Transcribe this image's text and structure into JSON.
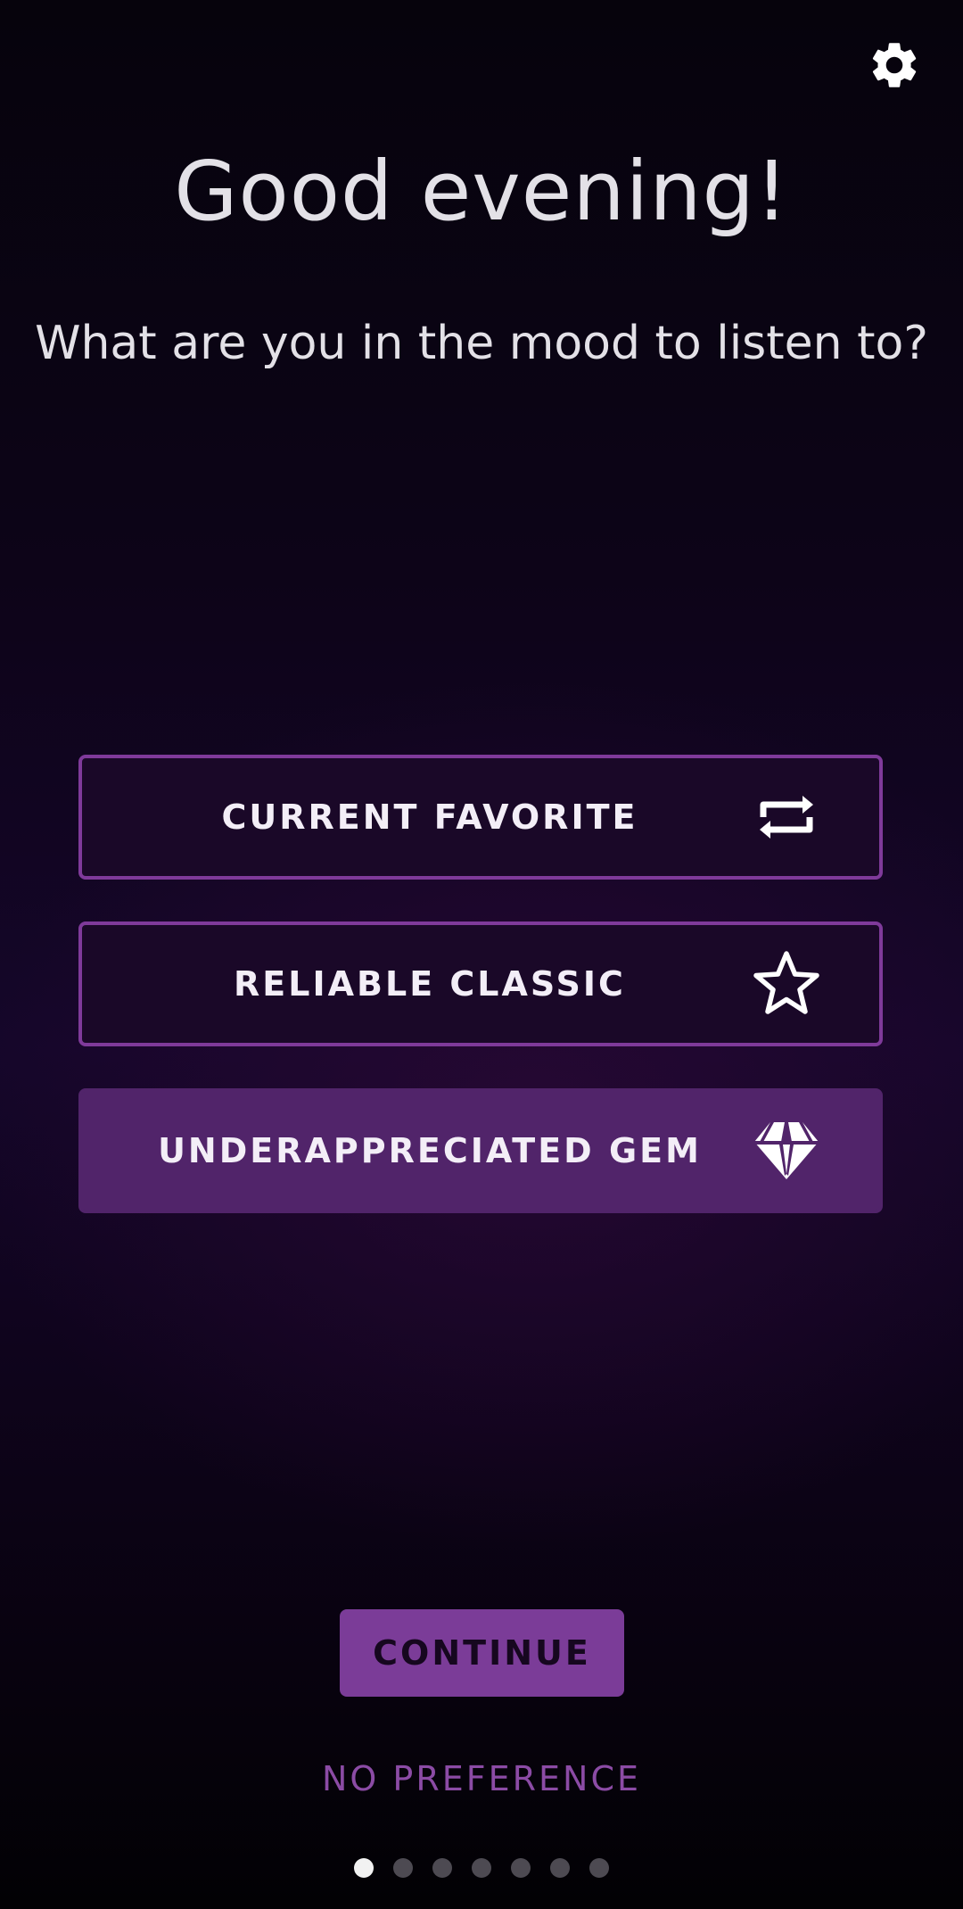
{
  "header": {
    "settings_icon": "gear-icon",
    "greeting": "Good evening!",
    "prompt": "What are you in the mood to listen to?"
  },
  "options": [
    {
      "label": "CURRENT FAVORITE",
      "icon": "repeat-icon",
      "selected": false
    },
    {
      "label": "RELIABLE CLASSIC",
      "icon": "star-icon",
      "selected": false
    },
    {
      "label": "UNDERAPPRECIATED GEM",
      "icon": "gem-icon",
      "selected": true
    }
  ],
  "actions": {
    "continue_label": "CONTINUE",
    "no_preference_label": "NO PREFERENCE"
  },
  "pagination": {
    "total": 7,
    "current": 1
  },
  "colors": {
    "accent": "#7b3c98",
    "selected_fill": "#51246a",
    "option_border": "#7f3a9a",
    "text": "#e3e1e7"
  }
}
